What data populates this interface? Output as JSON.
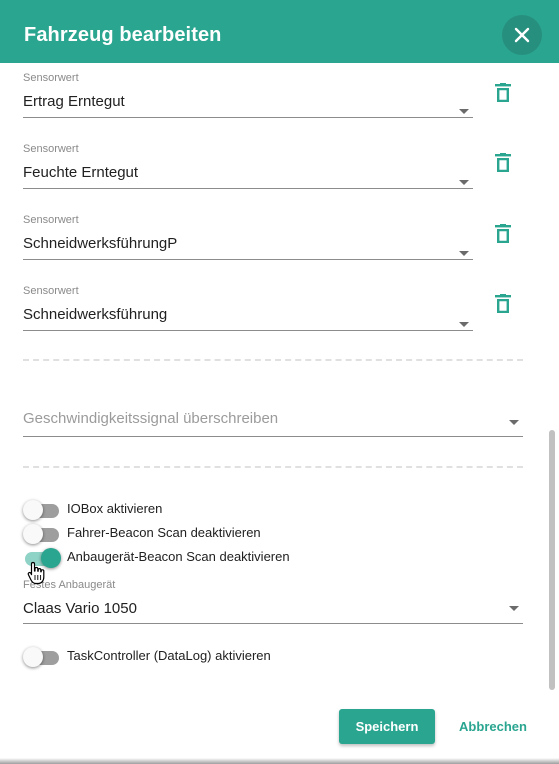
{
  "dialog": {
    "title": "Fahrzeug bearbeiten",
    "close_icon": "close-icon"
  },
  "sensors": [
    {
      "label": "Sensorwert",
      "value": "Ertrag Erntegut"
    },
    {
      "label": "Sensorwert",
      "value": "Feuchte Erntegut"
    },
    {
      "label": "Sensorwert",
      "value": "SchneidwerksführungP"
    },
    {
      "label": "Sensorwert",
      "value": "Schneidwerksführung"
    }
  ],
  "speed_signal": {
    "placeholder": "Geschwindigkeitssignal überschreiben"
  },
  "toggles": [
    {
      "label": "IOBox aktivieren",
      "on": false
    },
    {
      "label": "Fahrer-Beacon Scan deaktivieren",
      "on": false
    },
    {
      "label": "Anbaugerät-Beacon Scan deaktivieren",
      "on": true
    }
  ],
  "fixed_attachment": {
    "label": "Festes Anbaugerät",
    "value": "Claas Vario 1050"
  },
  "task_controller": {
    "label": "TaskController (DataLog) aktivieren",
    "on": false
  },
  "footer": {
    "save_label": "Speichern",
    "cancel_label": "Abbrechen"
  },
  "colors": {
    "accent": "#2aa590",
    "header": "#2aa590"
  }
}
